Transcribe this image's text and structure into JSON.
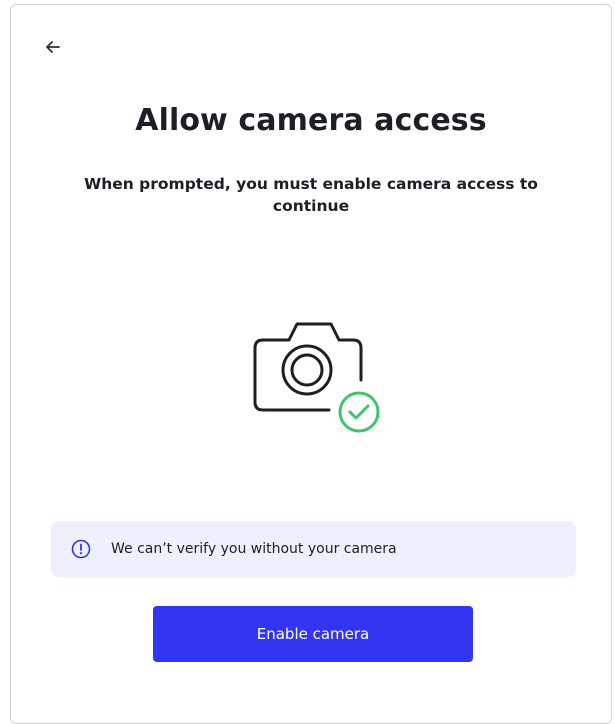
{
  "header": {
    "back_icon": "arrow-left-icon"
  },
  "main": {
    "title": "Allow camera access",
    "subtitle": "When prompted, you must enable camera access to continue",
    "illustration": {
      "camera_icon": "camera-icon",
      "check_icon": "check-circle-icon",
      "check_color": "#3ec46d"
    }
  },
  "notice": {
    "icon": "info-circle-icon",
    "icon_color": "#3435f0",
    "text": "We can’t verify you without your camera",
    "background": "#eef0fd"
  },
  "actions": {
    "enable_camera_label": "Enable camera",
    "button_color": "#3435f0"
  }
}
